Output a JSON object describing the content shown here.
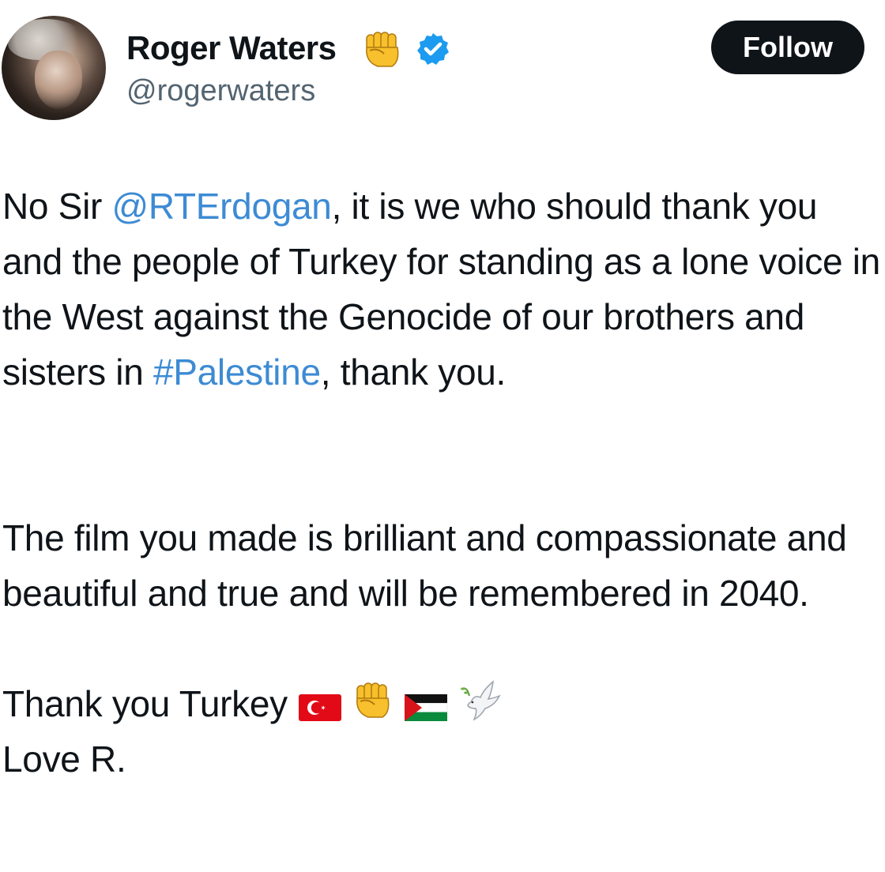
{
  "author": {
    "display_name": "Roger Waters",
    "name_emoji": "raised-fist-emoji",
    "verified_icon": "verified-badge-icon",
    "handle": "@rogerwaters"
  },
  "follow_button": {
    "label": "Follow"
  },
  "tweet": {
    "para1": {
      "text1": "No Sir ",
      "mention": "@RTErdogan",
      "text2": ", it is we who should thank you and the people of Turkey for standing as a lone voice in the West against the Genocide of our brothers and sisters in ",
      "hashtag": "#Palestine",
      "text3": ", thank you."
    },
    "para2": {
      "text": "The film you made is brilliant and compassionate and beautiful and true and will be remembered in 2040."
    },
    "para3": {
      "line1": "Thank you Turkey",
      "emojis": [
        "turkey-flag-emoji",
        "raised-fist-emoji",
        "palestine-flag-emoji",
        "dove-emoji"
      ],
      "line2": "Love R."
    }
  },
  "colors": {
    "link": "#3d8bd4",
    "text": "#0f1419",
    "secondary_text": "#536471",
    "verified": "#1d9bf0",
    "button_bg": "#0f1419"
  }
}
